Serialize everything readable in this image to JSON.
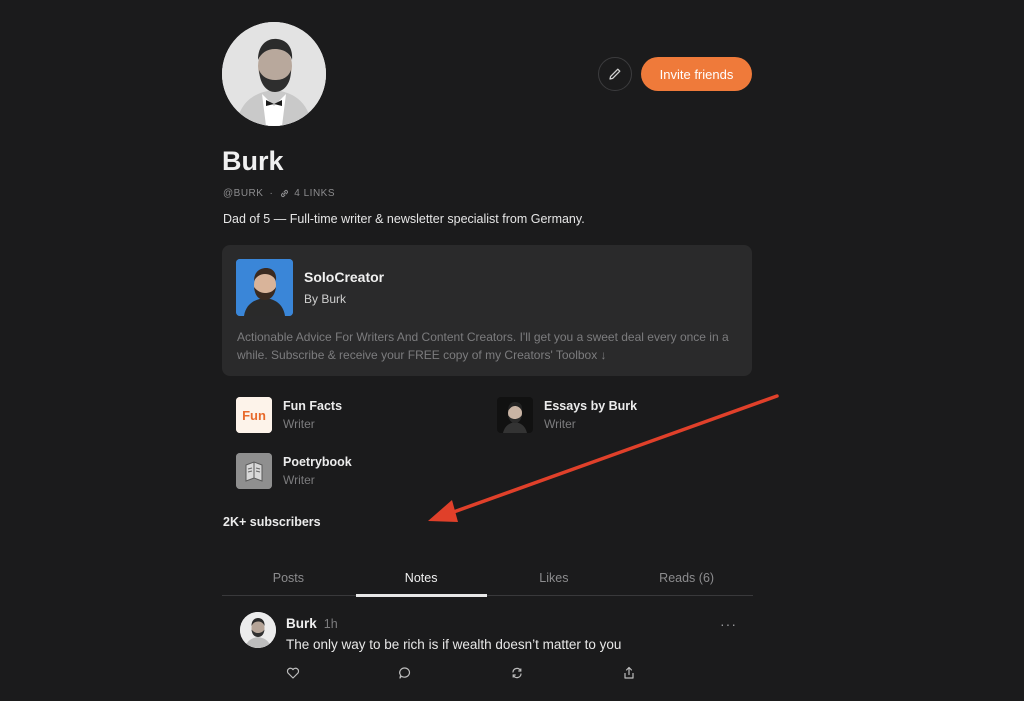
{
  "profile": {
    "name": "Burk",
    "handle": "@BURK",
    "separator": "·",
    "links": "4 LINKS",
    "bio": "Dad of 5 — Full-time writer & newsletter specialist from Germany."
  },
  "header": {
    "invite_label": "Invite friends",
    "edit_icon": "pencil-icon"
  },
  "publication": {
    "title": "SoloCreator",
    "by": "By Burk",
    "description": "Actionable Advice For Writers And Content Creators. I'll get you a sweet deal every once in a while. Subscribe & receive your FREE copy of my Creators' Toolbox ↓"
  },
  "roles": [
    {
      "name": "Fun Facts",
      "role": "Writer",
      "logo_text": "Fun"
    },
    {
      "name": "Essays by Burk",
      "role": "Writer"
    },
    {
      "name": "Poetrybook",
      "role": "Writer"
    }
  ],
  "subscribers": "2K+ subscribers",
  "tabs": [
    {
      "label": "Posts",
      "active": false
    },
    {
      "label": "Notes",
      "active": true
    },
    {
      "label": "Likes",
      "active": false
    },
    {
      "label": "Reads (6)",
      "active": false
    }
  ],
  "note": {
    "author": "Burk",
    "time": "1h",
    "text": "The only way to be rich is if wealth doesn’t matter to you",
    "more": "···"
  },
  "colors": {
    "accent": "#ef7a3a",
    "background": "#1b1b1c",
    "card": "#2a2a2b",
    "annotation_arrow": "#e0402a"
  }
}
